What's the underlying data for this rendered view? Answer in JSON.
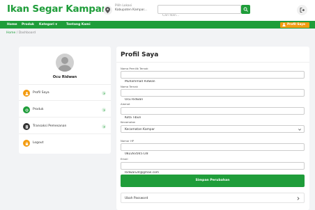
{
  "header": {
    "brand": "Ikan Segar Kampar",
    "location_line1": "Pilih Lokasi",
    "location_line2": "Kabupaten Kampar...",
    "search_placeholder": "Cari Ikan..."
  },
  "nav": {
    "items": [
      "Home",
      "Produk",
      "Kategori",
      "Tentang Kami"
    ],
    "profile_button": "Profil Saya"
  },
  "breadcrumb": {
    "home": "Home",
    "separator": "/",
    "current": "Dashboard"
  },
  "sidebar": {
    "user_name": "Ocu Ridwan",
    "menu": [
      {
        "label": "Profil Saya",
        "icon": "user-icon",
        "color": "#f39c12"
      },
      {
        "label": "Produk",
        "icon": "box-icon",
        "color": "#1f9d3a"
      },
      {
        "label": "Transaksi Pemesanan",
        "icon": "document-icon",
        "color": "#333333"
      },
      {
        "label": "Logout",
        "icon": "lock-icon",
        "color": "#f39c12"
      }
    ]
  },
  "profile_form": {
    "title": "Profil Saya",
    "fields": [
      {
        "label": "Nama Pemilik Ternak",
        "value": "Muhammad Ridwan"
      },
      {
        "label": "Nama Ternak",
        "value": "Ocu Ridwan"
      },
      {
        "label": "Alamat",
        "value": "Kota Tibun"
      },
      {
        "label": "Kecamatan",
        "value": "Kecamatan Kampar"
      },
      {
        "label": "Nomor HP",
        "value": "082283565728"
      },
      {
        "label": "Email",
        "value": "Ridwan24@gmail.com"
      }
    ],
    "save_label": "Simpan Perubahan",
    "change_password_label": "Ubah Password"
  },
  "colors": {
    "brand_green": "#1f9d3a",
    "accent_orange": "#f39c12"
  }
}
